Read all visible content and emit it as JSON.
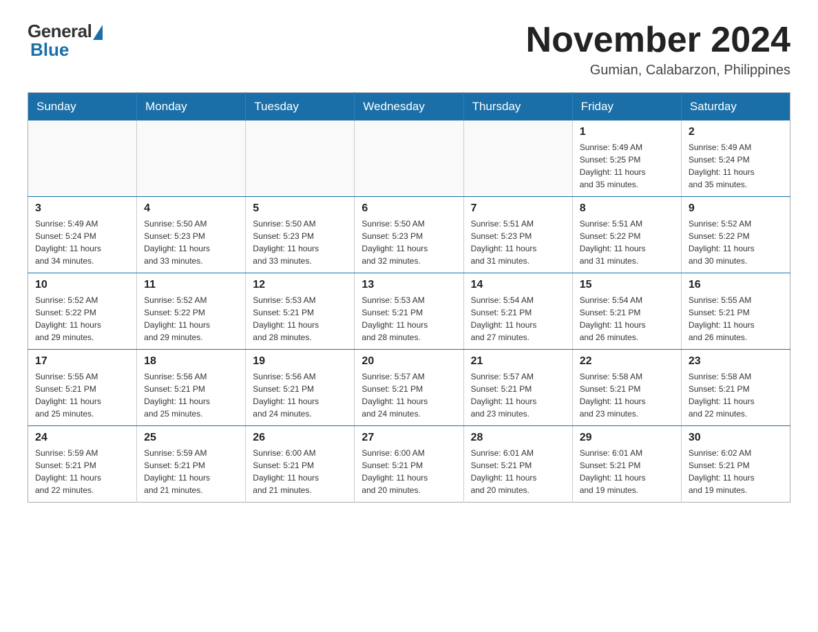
{
  "logo": {
    "general": "General",
    "blue": "Blue"
  },
  "title": "November 2024",
  "location": "Gumian, Calabarzon, Philippines",
  "weekdays": [
    "Sunday",
    "Monday",
    "Tuesday",
    "Wednesday",
    "Thursday",
    "Friday",
    "Saturday"
  ],
  "weeks": [
    {
      "days": [
        {
          "number": "",
          "info": ""
        },
        {
          "number": "",
          "info": ""
        },
        {
          "number": "",
          "info": ""
        },
        {
          "number": "",
          "info": ""
        },
        {
          "number": "",
          "info": ""
        },
        {
          "number": "1",
          "info": "Sunrise: 5:49 AM\nSunset: 5:25 PM\nDaylight: 11 hours\nand 35 minutes."
        },
        {
          "number": "2",
          "info": "Sunrise: 5:49 AM\nSunset: 5:24 PM\nDaylight: 11 hours\nand 35 minutes."
        }
      ]
    },
    {
      "days": [
        {
          "number": "3",
          "info": "Sunrise: 5:49 AM\nSunset: 5:24 PM\nDaylight: 11 hours\nand 34 minutes."
        },
        {
          "number": "4",
          "info": "Sunrise: 5:50 AM\nSunset: 5:23 PM\nDaylight: 11 hours\nand 33 minutes."
        },
        {
          "number": "5",
          "info": "Sunrise: 5:50 AM\nSunset: 5:23 PM\nDaylight: 11 hours\nand 33 minutes."
        },
        {
          "number": "6",
          "info": "Sunrise: 5:50 AM\nSunset: 5:23 PM\nDaylight: 11 hours\nand 32 minutes."
        },
        {
          "number": "7",
          "info": "Sunrise: 5:51 AM\nSunset: 5:23 PM\nDaylight: 11 hours\nand 31 minutes."
        },
        {
          "number": "8",
          "info": "Sunrise: 5:51 AM\nSunset: 5:22 PM\nDaylight: 11 hours\nand 31 minutes."
        },
        {
          "number": "9",
          "info": "Sunrise: 5:52 AM\nSunset: 5:22 PM\nDaylight: 11 hours\nand 30 minutes."
        }
      ]
    },
    {
      "days": [
        {
          "number": "10",
          "info": "Sunrise: 5:52 AM\nSunset: 5:22 PM\nDaylight: 11 hours\nand 29 minutes."
        },
        {
          "number": "11",
          "info": "Sunrise: 5:52 AM\nSunset: 5:22 PM\nDaylight: 11 hours\nand 29 minutes."
        },
        {
          "number": "12",
          "info": "Sunrise: 5:53 AM\nSunset: 5:21 PM\nDaylight: 11 hours\nand 28 minutes."
        },
        {
          "number": "13",
          "info": "Sunrise: 5:53 AM\nSunset: 5:21 PM\nDaylight: 11 hours\nand 28 minutes."
        },
        {
          "number": "14",
          "info": "Sunrise: 5:54 AM\nSunset: 5:21 PM\nDaylight: 11 hours\nand 27 minutes."
        },
        {
          "number": "15",
          "info": "Sunrise: 5:54 AM\nSunset: 5:21 PM\nDaylight: 11 hours\nand 26 minutes."
        },
        {
          "number": "16",
          "info": "Sunrise: 5:55 AM\nSunset: 5:21 PM\nDaylight: 11 hours\nand 26 minutes."
        }
      ]
    },
    {
      "days": [
        {
          "number": "17",
          "info": "Sunrise: 5:55 AM\nSunset: 5:21 PM\nDaylight: 11 hours\nand 25 minutes."
        },
        {
          "number": "18",
          "info": "Sunrise: 5:56 AM\nSunset: 5:21 PM\nDaylight: 11 hours\nand 25 minutes."
        },
        {
          "number": "19",
          "info": "Sunrise: 5:56 AM\nSunset: 5:21 PM\nDaylight: 11 hours\nand 24 minutes."
        },
        {
          "number": "20",
          "info": "Sunrise: 5:57 AM\nSunset: 5:21 PM\nDaylight: 11 hours\nand 24 minutes."
        },
        {
          "number": "21",
          "info": "Sunrise: 5:57 AM\nSunset: 5:21 PM\nDaylight: 11 hours\nand 23 minutes."
        },
        {
          "number": "22",
          "info": "Sunrise: 5:58 AM\nSunset: 5:21 PM\nDaylight: 11 hours\nand 23 minutes."
        },
        {
          "number": "23",
          "info": "Sunrise: 5:58 AM\nSunset: 5:21 PM\nDaylight: 11 hours\nand 22 minutes."
        }
      ]
    },
    {
      "days": [
        {
          "number": "24",
          "info": "Sunrise: 5:59 AM\nSunset: 5:21 PM\nDaylight: 11 hours\nand 22 minutes."
        },
        {
          "number": "25",
          "info": "Sunrise: 5:59 AM\nSunset: 5:21 PM\nDaylight: 11 hours\nand 21 minutes."
        },
        {
          "number": "26",
          "info": "Sunrise: 6:00 AM\nSunset: 5:21 PM\nDaylight: 11 hours\nand 21 minutes."
        },
        {
          "number": "27",
          "info": "Sunrise: 6:00 AM\nSunset: 5:21 PM\nDaylight: 11 hours\nand 20 minutes."
        },
        {
          "number": "28",
          "info": "Sunrise: 6:01 AM\nSunset: 5:21 PM\nDaylight: 11 hours\nand 20 minutes."
        },
        {
          "number": "29",
          "info": "Sunrise: 6:01 AM\nSunset: 5:21 PM\nDaylight: 11 hours\nand 19 minutes."
        },
        {
          "number": "30",
          "info": "Sunrise: 6:02 AM\nSunset: 5:21 PM\nDaylight: 11 hours\nand 19 minutes."
        }
      ]
    }
  ]
}
